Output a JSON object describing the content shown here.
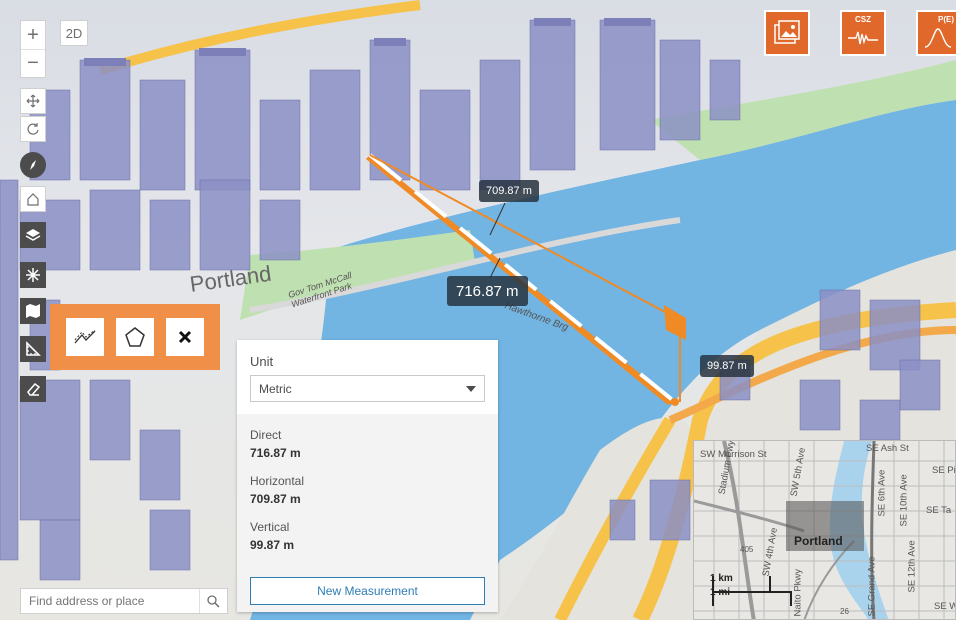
{
  "toolbar": {
    "zoom_in": "+",
    "zoom_out": "−",
    "view_toggle": "2D"
  },
  "top_widgets": [
    {
      "name": "image-widget",
      "tag": ""
    },
    {
      "name": "csz-widget",
      "tag": "CSZ"
    },
    {
      "name": "probability-widget",
      "tag": "P(E)"
    }
  ],
  "map": {
    "city_label": "Portland",
    "labels": [
      "Gov Tom McCall Waterfront Park",
      "Hawthorne Brg"
    ]
  },
  "measurement_labels": {
    "horizontal": "709.87 m",
    "direct": "716.87 m",
    "vertical": "99.87 m"
  },
  "panel": {
    "unit_label": "Unit",
    "unit_value": "Metric",
    "results": [
      {
        "label": "Direct",
        "value": "716.87 m"
      },
      {
        "label": "Horizontal",
        "value": "709.87 m"
      },
      {
        "label": "Vertical",
        "value": "99.87 m"
      }
    ],
    "new_measurement": "New Measurement"
  },
  "search": {
    "placeholder": "Find address or place"
  },
  "overview": {
    "city": "Portland",
    "scale_km": "1 km",
    "scale_mi": "1 mi",
    "labels": [
      "SW Morrison St",
      "SE Ash St",
      "Stadium Fwy",
      "SW 5th Ave",
      "SW 4th Ave",
      "SE 6th Ave",
      "SE 10th Ave",
      "SE 12th Ave",
      "SE Grand Ave",
      "SE Ta",
      "SE Pi",
      "SE W",
      "Naito Pkwy",
      "405",
      "26"
    ]
  },
  "colors": {
    "accent": "#e1682b",
    "measure_orange": "#f08a24",
    "water": "#6fb3e0",
    "building": "#8b8fc4",
    "link": "#2f7db5"
  }
}
